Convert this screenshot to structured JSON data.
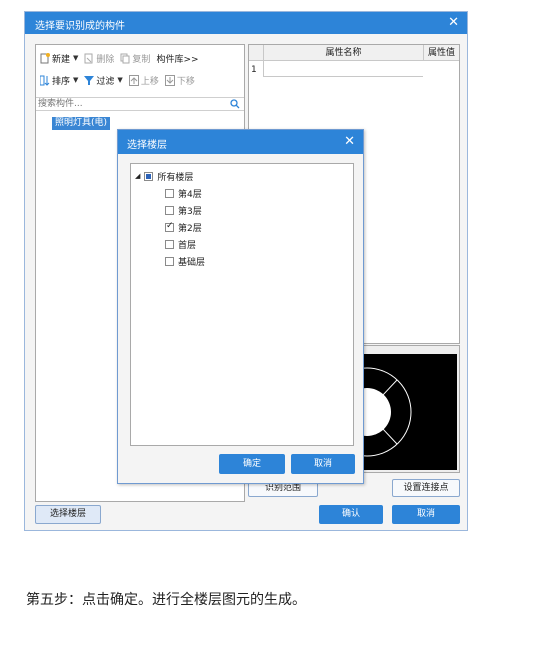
{
  "main_dialog": {
    "title": "选择要识别成的构件",
    "toolbar1": {
      "new": "新建",
      "delete": "删除",
      "copy": "复制",
      "library": "构件库>>"
    },
    "toolbar2": {
      "sort": "排序",
      "filter": "过滤",
      "move_up": "上移",
      "move_down": "下移"
    },
    "search_placeholder": "搜索构件...",
    "tree_items": [
      "照明灯具(电)"
    ],
    "grid": {
      "col_name": "属性名称",
      "col_value": "属性值",
      "rows": [
        "1"
      ]
    },
    "buttons": {
      "identify_range": "识别范围",
      "set_connection": "设置连接点",
      "select_floor": "选择楼层",
      "confirm": "确认",
      "cancel": "取消"
    }
  },
  "floor_dialog": {
    "title": "选择楼层",
    "root": {
      "label": "所有楼层",
      "state": "partial"
    },
    "floors": [
      {
        "label": "第4层",
        "checked": false
      },
      {
        "label": "第3层",
        "checked": false
      },
      {
        "label": "第2层",
        "checked": true
      },
      {
        "label": "首层",
        "checked": false
      },
      {
        "label": "基础层",
        "checked": false
      }
    ],
    "buttons": {
      "ok": "确定",
      "cancel": "取消"
    }
  },
  "caption": "第五步：点击确定。进行全楼层图元的生成。",
  "colors": {
    "accent": "#2d84d8",
    "preview_bg": "#000000",
    "preview_stroke": "#ffffff"
  },
  "icons": {
    "close": "close-icon",
    "search": "search-icon"
  }
}
